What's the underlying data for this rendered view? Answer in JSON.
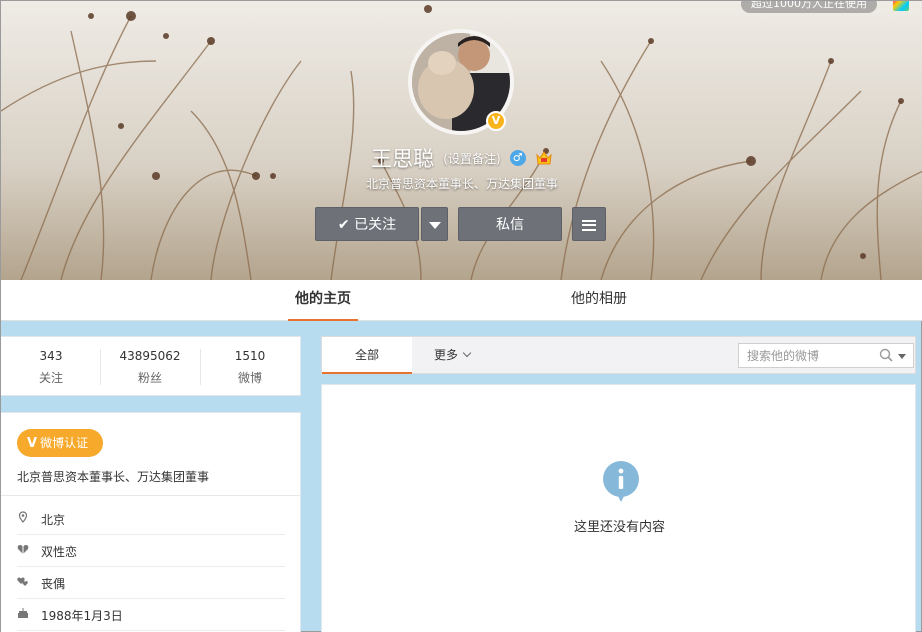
{
  "header": {
    "top_badge": "超过1000万人正在使用",
    "name": "王思聪",
    "remark_label": "(设置备注)",
    "gender_symbol": "♂",
    "description": "北京普思资本董事长、万达集团董事",
    "verified_mark": "V",
    "buttons": {
      "follow_check": "✔",
      "follow_label": "已关注",
      "message_label": "私信"
    }
  },
  "tabs": [
    {
      "label": "他的主页",
      "active": true
    },
    {
      "label": "他的相册",
      "active": false
    }
  ],
  "stats": [
    {
      "value": "343",
      "label": "关注"
    },
    {
      "value": "43895062",
      "label": "粉丝"
    },
    {
      "value": "1510",
      "label": "微博"
    }
  ],
  "profile": {
    "verified_mark": "V",
    "verified_label": "微博认证",
    "description": "北京普思资本董事长、万达集团董事",
    "details": [
      {
        "icon": "location-icon",
        "text": "北京"
      },
      {
        "icon": "orientation-icon",
        "text": "双性恋"
      },
      {
        "icon": "relationship-icon",
        "text": "丧偶"
      },
      {
        "icon": "birthday-icon",
        "text": "1988年1月3日"
      }
    ]
  },
  "feed": {
    "tab_all": "全部",
    "tab_more": "更多",
    "search_placeholder": "搜索他的微博",
    "empty_text": "这里还没有内容"
  },
  "colors": {
    "accent": "#e8732e",
    "verified": "#f7a92c",
    "button": "#6e7178",
    "page_bg": "#b8dcef",
    "info_icon": "#86b9d9"
  }
}
